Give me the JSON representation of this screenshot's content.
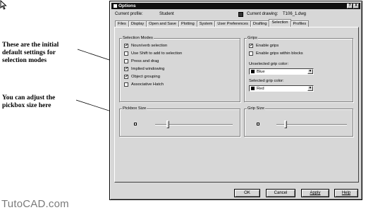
{
  "annotations": {
    "selection_modes_note": [
      "These are the initial",
      "default settings for",
      "selection modes"
    ],
    "pickbox_note": [
      "You can adjust the",
      "pickbox size here"
    ],
    "watermark": "TutoCAD.com"
  },
  "dialog": {
    "title": "Options",
    "title_buttons": [
      "?",
      "X"
    ],
    "current_profile_label": "Current profile:",
    "current_profile_value": "Student",
    "current_drawing_label": "Current drawing:",
    "current_drawing_value": "T106_1.dwg",
    "tabs": [
      {
        "label": "Files",
        "active": false
      },
      {
        "label": "Display",
        "active": false
      },
      {
        "label": "Open and Save",
        "active": false
      },
      {
        "label": "Plotting",
        "active": false
      },
      {
        "label": "System",
        "active": false
      },
      {
        "label": "User Preferences",
        "active": false
      },
      {
        "label": "Drafting",
        "active": false
      },
      {
        "label": "Selection",
        "active": true
      },
      {
        "label": "Profiles",
        "active": false
      }
    ],
    "selection_modes": {
      "title": "Selection Modes",
      "items": [
        {
          "label": "Noun/verb selection",
          "checked": true
        },
        {
          "label": "Use Shift to add to selection",
          "checked": false
        },
        {
          "label": "Press and drag",
          "checked": false
        },
        {
          "label": "Implied windowing",
          "checked": true
        },
        {
          "label": "Object grouping",
          "checked": true
        },
        {
          "label": "Associative Hatch",
          "checked": false
        }
      ]
    },
    "grips": {
      "title": "Grips",
      "items": [
        {
          "label": "Enable grips",
          "checked": true
        },
        {
          "label": "Enable grips within blocks",
          "checked": false
        }
      ],
      "unselected_label": "Unselected grip color:",
      "unselected_value": "Blue",
      "selected_label": "Selected grip color:",
      "selected_value": "Red"
    },
    "pickbox": {
      "title": "Pickbox Size",
      "level": 0.12
    },
    "gripsize": {
      "title": "Grip Size",
      "level": 0.12
    },
    "buttons": {
      "ok": "OK",
      "cancel": "Cancel",
      "apply": "Apply",
      "help": "Help"
    },
    "colors": {
      "blue_swatch": "#000000",
      "red_swatch": "#000000"
    }
  }
}
